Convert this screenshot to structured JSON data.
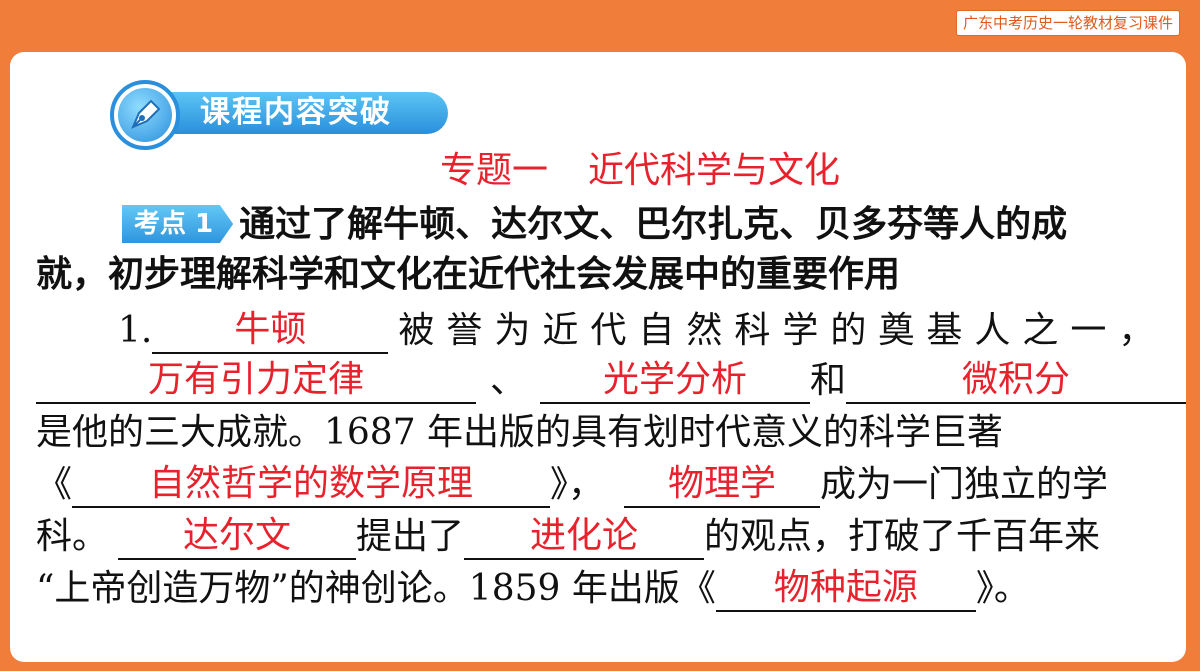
{
  "header": {
    "course_tag": "广东中考历史一轮教材复习课件"
  },
  "section": {
    "label": "课程内容突破"
  },
  "topic": {
    "number": "专题一",
    "title": "近代科学与文化"
  },
  "kaodian": {
    "badge": "考点 1",
    "line1": "通过了解牛顿、达尔文、巴尔扎克、贝多芬等人的成",
    "line2": "就，初步理解科学和文化在近代社会发展中的重要作用"
  },
  "q1": {
    "num": "1.",
    "a1": "牛顿",
    "t1": "被誉为近代自然科学的奠基人之一，",
    "a2": "万有引力定律",
    "sep1": "、",
    "a3": "光学分析",
    "t2": "和",
    "a4": "微积分",
    "t3": "是他的三大成就。1687 年出版的具有划时代意义的科学巨著",
    "open1": "《",
    "a5": "自然哲学的数学原理",
    "close1": "》，",
    "a6": "物理学",
    "t4": "成为一门独立的学",
    "t5": "科。",
    "a7": "达尔文",
    "t6": "提出了",
    "a8": "进化论",
    "t7": "的观点，打破了千百年来",
    "t8": "“上帝创造万物”的神创论。1859 年出版《",
    "a9": "物种起源",
    "t9": "》。"
  },
  "colors": {
    "accent": "#e8222c",
    "frame": "#f07d3a",
    "badge_blue": "#2a8fdc"
  }
}
